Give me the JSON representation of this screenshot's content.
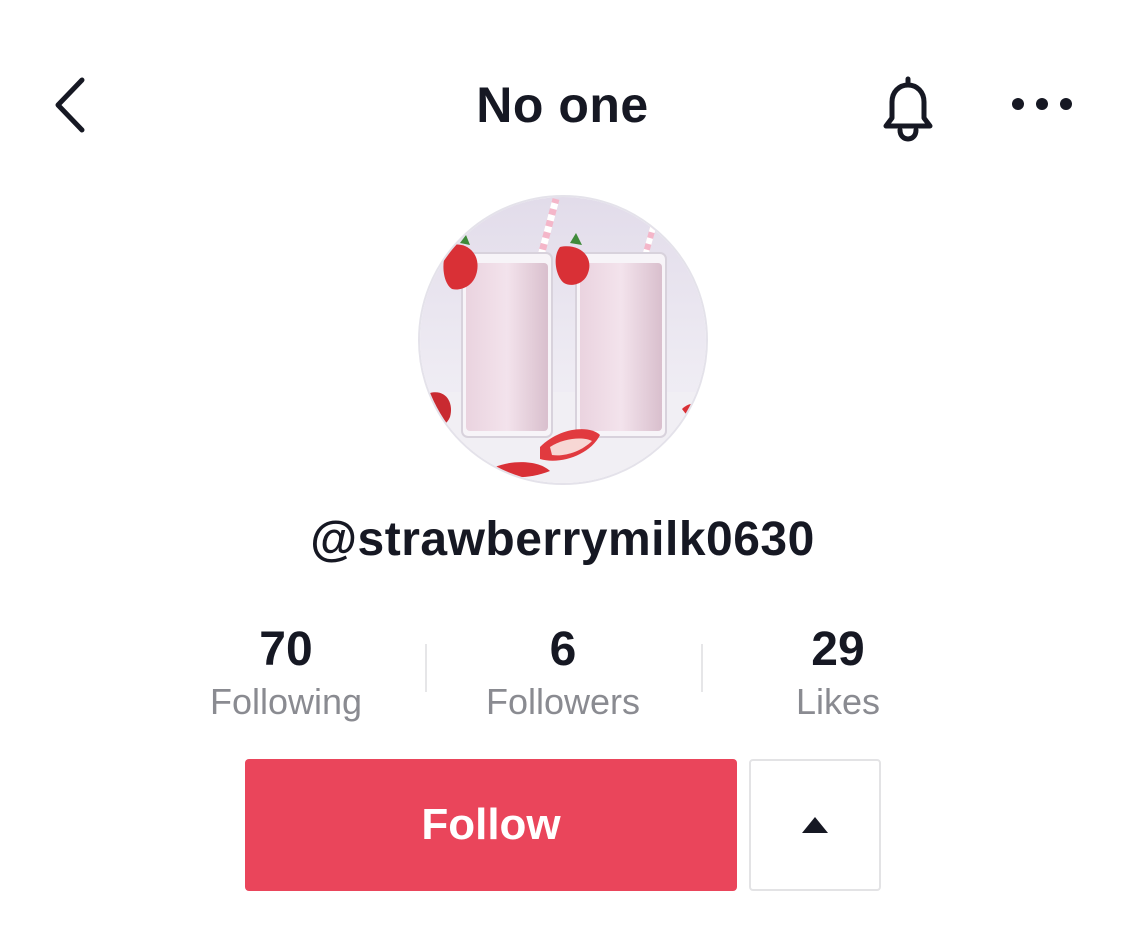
{
  "header": {
    "title": "No one",
    "back_icon": "chevron-left-icon",
    "notification_icon": "bell-icon",
    "more_icon": "more-horizontal-icon"
  },
  "profile": {
    "username": "@strawberrymilk0630",
    "avatar": "strawberry-milk-glasses-photo"
  },
  "stats": [
    {
      "value": "70",
      "label": "Following"
    },
    {
      "value": "6",
      "label": "Followers"
    },
    {
      "value": "29",
      "label": "Likes"
    }
  ],
  "actions": {
    "follow_label": "Follow",
    "suggest_icon": "caret-up-icon"
  },
  "colors": {
    "accent": "#EA455B",
    "text_primary": "#161823",
    "text_secondary": "#8A8B91"
  }
}
